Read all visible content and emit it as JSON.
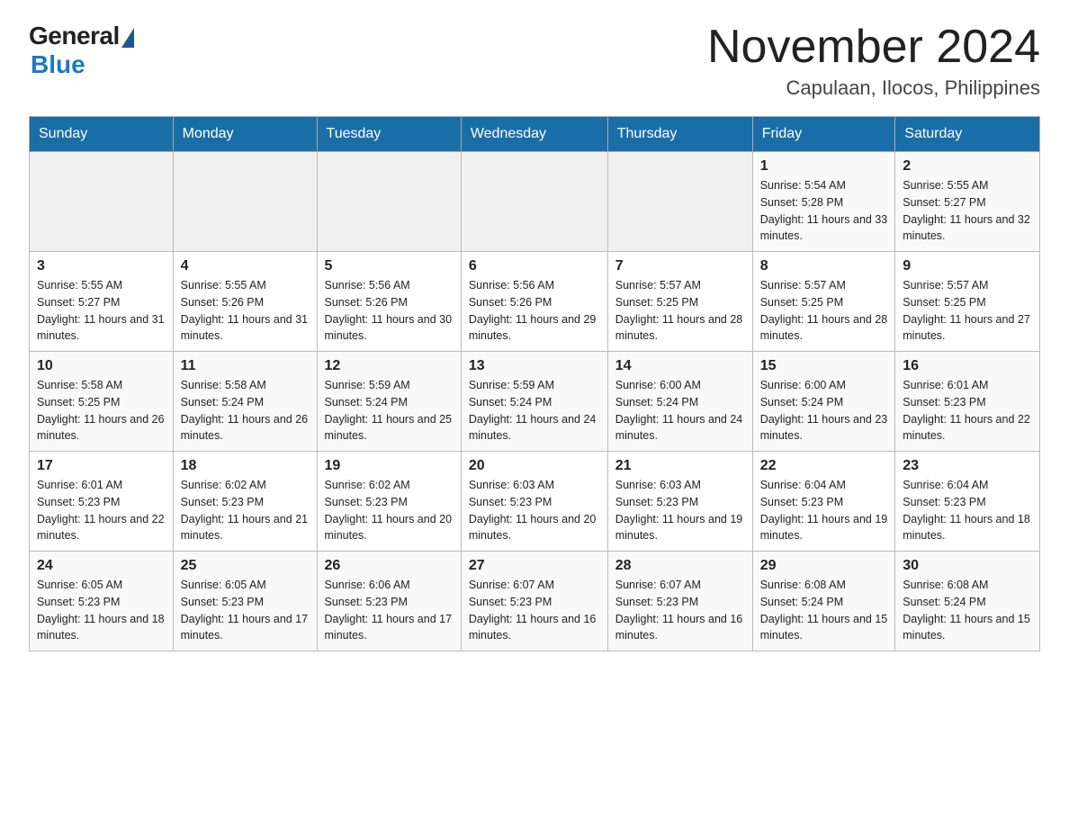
{
  "header": {
    "logo_general": "General",
    "logo_blue": "Blue",
    "title_month": "November 2024",
    "title_location": "Capulaan, Ilocos, Philippines"
  },
  "weekdays": [
    "Sunday",
    "Monday",
    "Tuesday",
    "Wednesday",
    "Thursday",
    "Friday",
    "Saturday"
  ],
  "weeks": [
    [
      {
        "day": "",
        "info": ""
      },
      {
        "day": "",
        "info": ""
      },
      {
        "day": "",
        "info": ""
      },
      {
        "day": "",
        "info": ""
      },
      {
        "day": "",
        "info": ""
      },
      {
        "day": "1",
        "info": "Sunrise: 5:54 AM\nSunset: 5:28 PM\nDaylight: 11 hours and 33 minutes."
      },
      {
        "day": "2",
        "info": "Sunrise: 5:55 AM\nSunset: 5:27 PM\nDaylight: 11 hours and 32 minutes."
      }
    ],
    [
      {
        "day": "3",
        "info": "Sunrise: 5:55 AM\nSunset: 5:27 PM\nDaylight: 11 hours and 31 minutes."
      },
      {
        "day": "4",
        "info": "Sunrise: 5:55 AM\nSunset: 5:26 PM\nDaylight: 11 hours and 31 minutes."
      },
      {
        "day": "5",
        "info": "Sunrise: 5:56 AM\nSunset: 5:26 PM\nDaylight: 11 hours and 30 minutes."
      },
      {
        "day": "6",
        "info": "Sunrise: 5:56 AM\nSunset: 5:26 PM\nDaylight: 11 hours and 29 minutes."
      },
      {
        "day": "7",
        "info": "Sunrise: 5:57 AM\nSunset: 5:25 PM\nDaylight: 11 hours and 28 minutes."
      },
      {
        "day": "8",
        "info": "Sunrise: 5:57 AM\nSunset: 5:25 PM\nDaylight: 11 hours and 28 minutes."
      },
      {
        "day": "9",
        "info": "Sunrise: 5:57 AM\nSunset: 5:25 PM\nDaylight: 11 hours and 27 minutes."
      }
    ],
    [
      {
        "day": "10",
        "info": "Sunrise: 5:58 AM\nSunset: 5:25 PM\nDaylight: 11 hours and 26 minutes."
      },
      {
        "day": "11",
        "info": "Sunrise: 5:58 AM\nSunset: 5:24 PM\nDaylight: 11 hours and 26 minutes."
      },
      {
        "day": "12",
        "info": "Sunrise: 5:59 AM\nSunset: 5:24 PM\nDaylight: 11 hours and 25 minutes."
      },
      {
        "day": "13",
        "info": "Sunrise: 5:59 AM\nSunset: 5:24 PM\nDaylight: 11 hours and 24 minutes."
      },
      {
        "day": "14",
        "info": "Sunrise: 6:00 AM\nSunset: 5:24 PM\nDaylight: 11 hours and 24 minutes."
      },
      {
        "day": "15",
        "info": "Sunrise: 6:00 AM\nSunset: 5:24 PM\nDaylight: 11 hours and 23 minutes."
      },
      {
        "day": "16",
        "info": "Sunrise: 6:01 AM\nSunset: 5:23 PM\nDaylight: 11 hours and 22 minutes."
      }
    ],
    [
      {
        "day": "17",
        "info": "Sunrise: 6:01 AM\nSunset: 5:23 PM\nDaylight: 11 hours and 22 minutes."
      },
      {
        "day": "18",
        "info": "Sunrise: 6:02 AM\nSunset: 5:23 PM\nDaylight: 11 hours and 21 minutes."
      },
      {
        "day": "19",
        "info": "Sunrise: 6:02 AM\nSunset: 5:23 PM\nDaylight: 11 hours and 20 minutes."
      },
      {
        "day": "20",
        "info": "Sunrise: 6:03 AM\nSunset: 5:23 PM\nDaylight: 11 hours and 20 minutes."
      },
      {
        "day": "21",
        "info": "Sunrise: 6:03 AM\nSunset: 5:23 PM\nDaylight: 11 hours and 19 minutes."
      },
      {
        "day": "22",
        "info": "Sunrise: 6:04 AM\nSunset: 5:23 PM\nDaylight: 11 hours and 19 minutes."
      },
      {
        "day": "23",
        "info": "Sunrise: 6:04 AM\nSunset: 5:23 PM\nDaylight: 11 hours and 18 minutes."
      }
    ],
    [
      {
        "day": "24",
        "info": "Sunrise: 6:05 AM\nSunset: 5:23 PM\nDaylight: 11 hours and 18 minutes."
      },
      {
        "day": "25",
        "info": "Sunrise: 6:05 AM\nSunset: 5:23 PM\nDaylight: 11 hours and 17 minutes."
      },
      {
        "day": "26",
        "info": "Sunrise: 6:06 AM\nSunset: 5:23 PM\nDaylight: 11 hours and 17 minutes."
      },
      {
        "day": "27",
        "info": "Sunrise: 6:07 AM\nSunset: 5:23 PM\nDaylight: 11 hours and 16 minutes."
      },
      {
        "day": "28",
        "info": "Sunrise: 6:07 AM\nSunset: 5:23 PM\nDaylight: 11 hours and 16 minutes."
      },
      {
        "day": "29",
        "info": "Sunrise: 6:08 AM\nSunset: 5:24 PM\nDaylight: 11 hours and 15 minutes."
      },
      {
        "day": "30",
        "info": "Sunrise: 6:08 AM\nSunset: 5:24 PM\nDaylight: 11 hours and 15 minutes."
      }
    ]
  ]
}
